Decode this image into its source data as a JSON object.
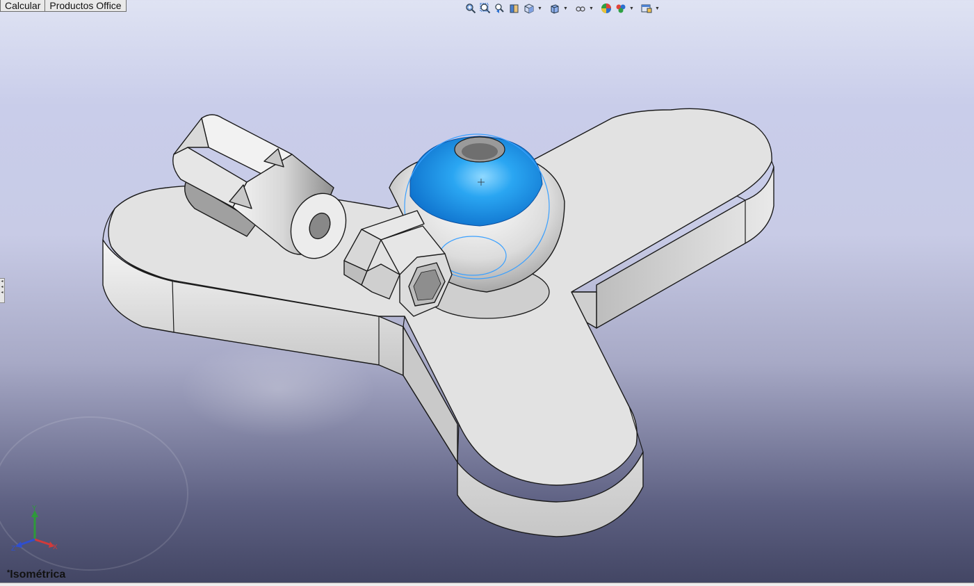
{
  "tabs": [
    "Calcular",
    "Productos Office"
  ],
  "toolbar": {
    "icons": [
      "zoom-to-fit-icon",
      "zoom-area-icon",
      "previous-view-icon",
      "section-view-icon",
      "view-orientation-icon",
      "display-style-icon",
      "hide-show-items-icon",
      "edit-appearance-icon",
      "apply-scene-icon",
      "view-settings-icon"
    ]
  },
  "view": {
    "name": "Isométrica",
    "modified_marker": "*"
  },
  "triad": {
    "x": "X",
    "y": "Y",
    "z": "Z"
  },
  "colors": {
    "part": "#e0e0e0",
    "part_edge": "#1a1a1a",
    "selected_face": "#1e8fe8",
    "highlight_edge": "#3aa0ff",
    "x_axis": "#d23a3a",
    "y_axis": "#2e9a3a",
    "z_axis": "#2f4fd0"
  }
}
